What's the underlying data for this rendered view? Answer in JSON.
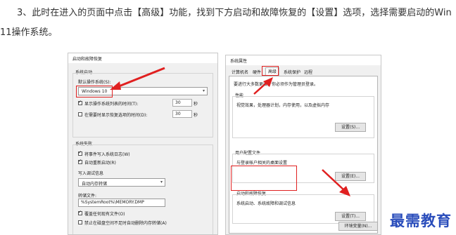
{
  "intro": {
    "line1": "3、此时在进入的页面中点击【高级】功能，找到下方启动和故障恢复的【设置】选项，选择需要启动的Win",
    "line2": "11操作系统。"
  },
  "startup_dialog": {
    "title": "启动和故障恢复",
    "system_startup": {
      "group_label": "系统启动",
      "default_os_label": "默认操作系统(S):",
      "default_os_value": "Windows 10",
      "show_os_list_label": "显示操作系统列表的时间(T):",
      "show_os_list_value": "30",
      "show_recovery_label": "在需要时显示恢复选项的时间(D):",
      "show_recovery_value": "30",
      "seconds": "秒"
    },
    "system_failure": {
      "group_label": "系统失败",
      "write_log_label": "将事件写入系统日志(W)",
      "auto_restart_label": "自动重新启动(R)",
      "debug_info_label": "写入调试信息",
      "debug_type_value": "自动内存转储",
      "dump_file_label": "转储文件:",
      "dump_file_value": "%SystemRoot%\\MEMORY.DMP",
      "overwrite_label": "覆盖任何现有文件(O)",
      "disable_low_space_label": "禁止在磁盘空间不足时自动删除内存转储(A)"
    }
  },
  "properties_dialog": {
    "title": "系统属性",
    "tabs": [
      "计算机名",
      "硬件",
      "高级",
      "系统保护",
      "远程"
    ],
    "admin_note": "要进行大多数更改，你必须作为管理员登录。",
    "performance": {
      "label": "性能",
      "desc": "视觉效果，处理器计划，内存使用，以及虚拟内存",
      "button": "设置(S)..."
    },
    "user_profiles": {
      "label": "用户配置文件",
      "desc": "与登录帐户相关的桌面设置",
      "button": "设置(E)..."
    },
    "startup_recovery": {
      "label": "启动和故障恢复",
      "desc": "系统启动、系统故障和调试信息",
      "button": "设置(T)..."
    },
    "env_button": "环境变量(N)..."
  },
  "watermark": "最需教育",
  "colors": {
    "annotation": "#e02020",
    "watermark": "#2a4dbb"
  }
}
